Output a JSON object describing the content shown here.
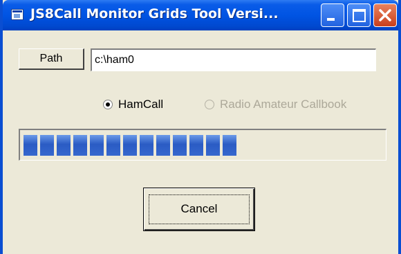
{
  "window": {
    "title": "JS8Call Monitor Grids Tool Versi..."
  },
  "path": {
    "button_label": "Path",
    "value": "c:\\ham0"
  },
  "source": {
    "options": [
      {
        "label": "HamCall",
        "selected": true,
        "enabled": true
      },
      {
        "label": "Radio Amateur Callbook",
        "selected": false,
        "enabled": false
      }
    ]
  },
  "progress": {
    "value_fraction": 0.61,
    "segments_filled": 13,
    "bar_color": "#3668CE"
  },
  "actions": {
    "cancel_label": "Cancel"
  }
}
